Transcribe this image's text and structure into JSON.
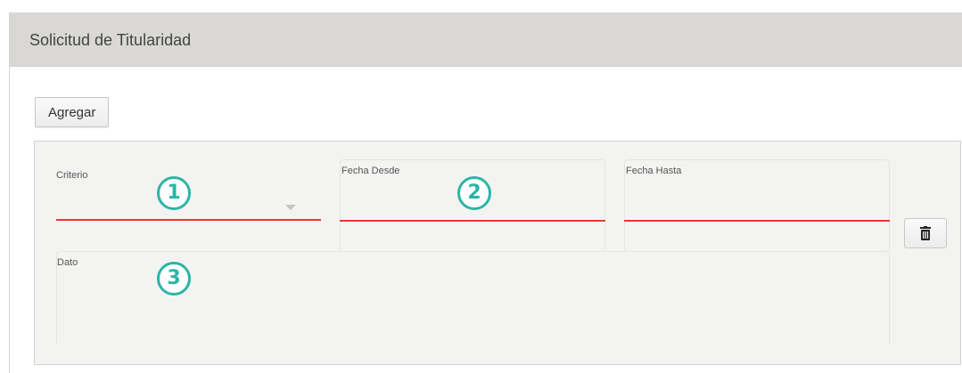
{
  "panel": {
    "title": "Solicitud de Titularidad"
  },
  "toolbar": {
    "add_label": "Agregar"
  },
  "form": {
    "criterio": {
      "label": "Criterio",
      "value": ""
    },
    "fecha_desde": {
      "label": "Fecha Desde",
      "value": ""
    },
    "fecha_hasta": {
      "label": "Fecha Hasta",
      "value": ""
    },
    "dato": {
      "label": "Dato",
      "value": ""
    },
    "delete_icon": "trash-icon"
  },
  "callouts": [
    "1",
    "2",
    "3"
  ],
  "colors": {
    "header_bg": "#d9d8d6",
    "form_bg": "#f3f3f2",
    "underline": "#e53935",
    "callout": "#2bb5a6"
  }
}
